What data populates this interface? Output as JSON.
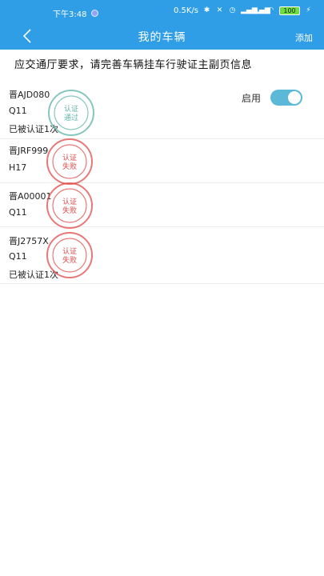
{
  "status": {
    "time": "下午3:48",
    "speed": "0.5K/s",
    "battery": "100",
    "network": "HD"
  },
  "nav": {
    "title": "我的车辆",
    "add_label": "添加"
  },
  "notice": "应交通厅要求，请完善车辆挂车行驶证主副页信息",
  "toggle_label": "启用",
  "vehicles": [
    {
      "plate": "晋AJD080",
      "model": "Q11",
      "auth": "已被认证1次",
      "stamp_text": [
        "认证",
        "通过"
      ],
      "stamp_color": "#5fb3a6",
      "enabled": true
    },
    {
      "plate": "晋JRF999",
      "model": "H17",
      "auth": "",
      "stamp_text": [
        "认证",
        "失败"
      ],
      "stamp_color": "#e04b4b",
      "enabled": false
    },
    {
      "plate": "晋A00001",
      "model": "Q11",
      "auth": "",
      "stamp_text": [
        "认证",
        "失败"
      ],
      "stamp_color": "#e04b4b",
      "enabled": false
    },
    {
      "plate": "晋J2757X",
      "model": "Q11",
      "auth": "已被认证1次",
      "stamp_text": [
        "认证",
        "失败"
      ],
      "stamp_color": "#e04b4b",
      "enabled": false
    }
  ],
  "colors": {
    "header": "#2f9ee6",
    "toggle_on": "#5bb8d6"
  }
}
